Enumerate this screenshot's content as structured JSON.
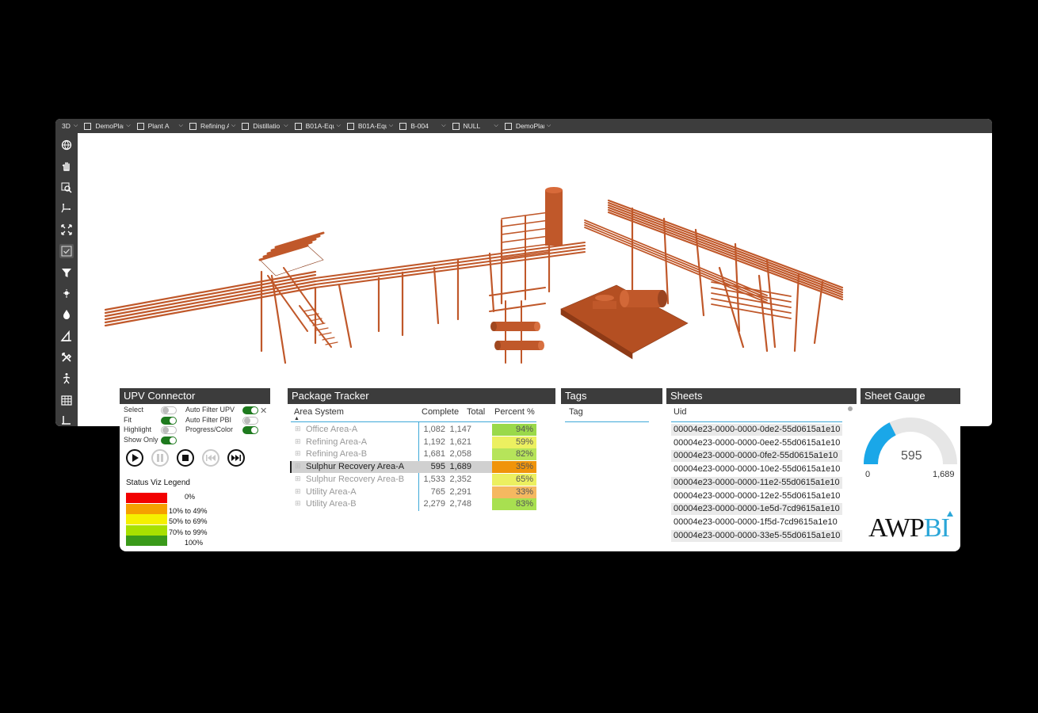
{
  "viewer": {
    "topbar": [
      {
        "label": "3D",
        "checkbox": false
      },
      {
        "label": "DemoPlar",
        "checkbox": true
      },
      {
        "label": "Plant A",
        "checkbox": true
      },
      {
        "label": "Refining A",
        "checkbox": true
      },
      {
        "label": "Distillatio",
        "checkbox": true
      },
      {
        "label": "B01A-Equ",
        "checkbox": true
      },
      {
        "label": "B01A-Equ",
        "checkbox": true
      },
      {
        "label": "B-004",
        "checkbox": true
      },
      {
        "label": "NULL",
        "checkbox": true
      },
      {
        "label": "DemoPlar",
        "checkbox": true
      }
    ],
    "tools": [
      "globe-icon",
      "hand-pan-icon",
      "zoom-area-icon",
      "axes-icon",
      "fit-extents-icon",
      "checkbox-icon",
      "filter-icon",
      "light-icon",
      "color-drop-icon",
      "measure-icon",
      "tools-icon",
      "walk-person-icon",
      "table-icon",
      "crop-corner-icon"
    ],
    "model_color": "#c0582a"
  },
  "upv": {
    "title": "UPV Connector",
    "toggles_left": [
      {
        "label": "Select",
        "on": false
      },
      {
        "label": "Fit",
        "on": true
      },
      {
        "label": "Highlight",
        "on": false
      },
      {
        "label": "Show Only",
        "on": true
      }
    ],
    "toggles_right": [
      {
        "label": "Auto Filter UPV",
        "on": true
      },
      {
        "label": "Auto Filter PBI",
        "on": false
      },
      {
        "label": "Progress/Color",
        "on": true
      }
    ],
    "close_glyph": "✕",
    "legend_title": "Status Viz Legend",
    "legend": [
      {
        "label": "0%",
        "color": "#f20000"
      },
      {
        "label": "10% to 49%",
        "color": "#f5a000"
      },
      {
        "label": "50% to 69%",
        "color": "#f5f000"
      },
      {
        "label": "70% to 99%",
        "color": "#a8e000"
      },
      {
        "label": "100%",
        "color": "#3a9a1a"
      }
    ]
  },
  "package_tracker": {
    "title": "Package Tracker",
    "columns": {
      "area": "Area System",
      "complete": "Complete",
      "total": "Total",
      "percent": "Percent %"
    },
    "rows": [
      {
        "area": "Office Area-A",
        "complete": "1,082",
        "total": "1,147",
        "percent": "94%",
        "color": "#9ad94a",
        "selected": false
      },
      {
        "area": "Refining Area-A",
        "complete": "1,192",
        "total": "1,621",
        "percent": "59%",
        "color": "#ecf060",
        "selected": false
      },
      {
        "area": "Refining Area-B",
        "complete": "1,681",
        "total": "2,058",
        "percent": "82%",
        "color": "#b6e45a",
        "selected": false
      },
      {
        "area": "Sulphur Recovery Area-A",
        "complete": "595",
        "total": "1,689",
        "percent": "35%",
        "color": "#f0940a",
        "selected": true
      },
      {
        "area": "Sulphur Recovery Area-B",
        "complete": "1,533",
        "total": "2,352",
        "percent": "65%",
        "color": "#ecf060",
        "selected": false
      },
      {
        "area": "Utility Area-A",
        "complete": "765",
        "total": "2,291",
        "percent": "33%",
        "color": "#f5b860",
        "selected": false
      },
      {
        "area": "Utility Area-B",
        "complete": "2,279",
        "total": "2,748",
        "percent": "83%",
        "color": "#a8e050",
        "selected": false
      }
    ]
  },
  "tags": {
    "title": "Tags",
    "column": "Tag"
  },
  "sheets": {
    "title": "Sheets",
    "column": "Uid",
    "rows": [
      "00004e23-0000-0000-0de2-55d0615a1e10",
      "00004e23-0000-0000-0ee2-55d0615a1e10",
      "00004e23-0000-0000-0fe2-55d0615a1e10",
      "00004e23-0000-0000-10e2-55d0615a1e10",
      "00004e23-0000-0000-11e2-55d0615a1e10",
      "00004e23-0000-0000-12e2-55d0615a1e10",
      "00004e23-0000-0000-1e5d-7cd9615a1e10",
      "00004e23-0000-0000-1f5d-7cd9615a1e10",
      "00004e23-0000-0000-33e5-55d0615a1e10"
    ]
  },
  "gauge": {
    "title": "Sheet Gauge",
    "value": 595,
    "min": 0,
    "max": 1689,
    "min_label": "0",
    "max_label": "1,689",
    "value_label": "595",
    "fill_color": "#1aa7e8",
    "track_color": "#e6e6e6"
  },
  "logo": {
    "text": "AWPBI",
    "accent": "#2aa6d8"
  }
}
